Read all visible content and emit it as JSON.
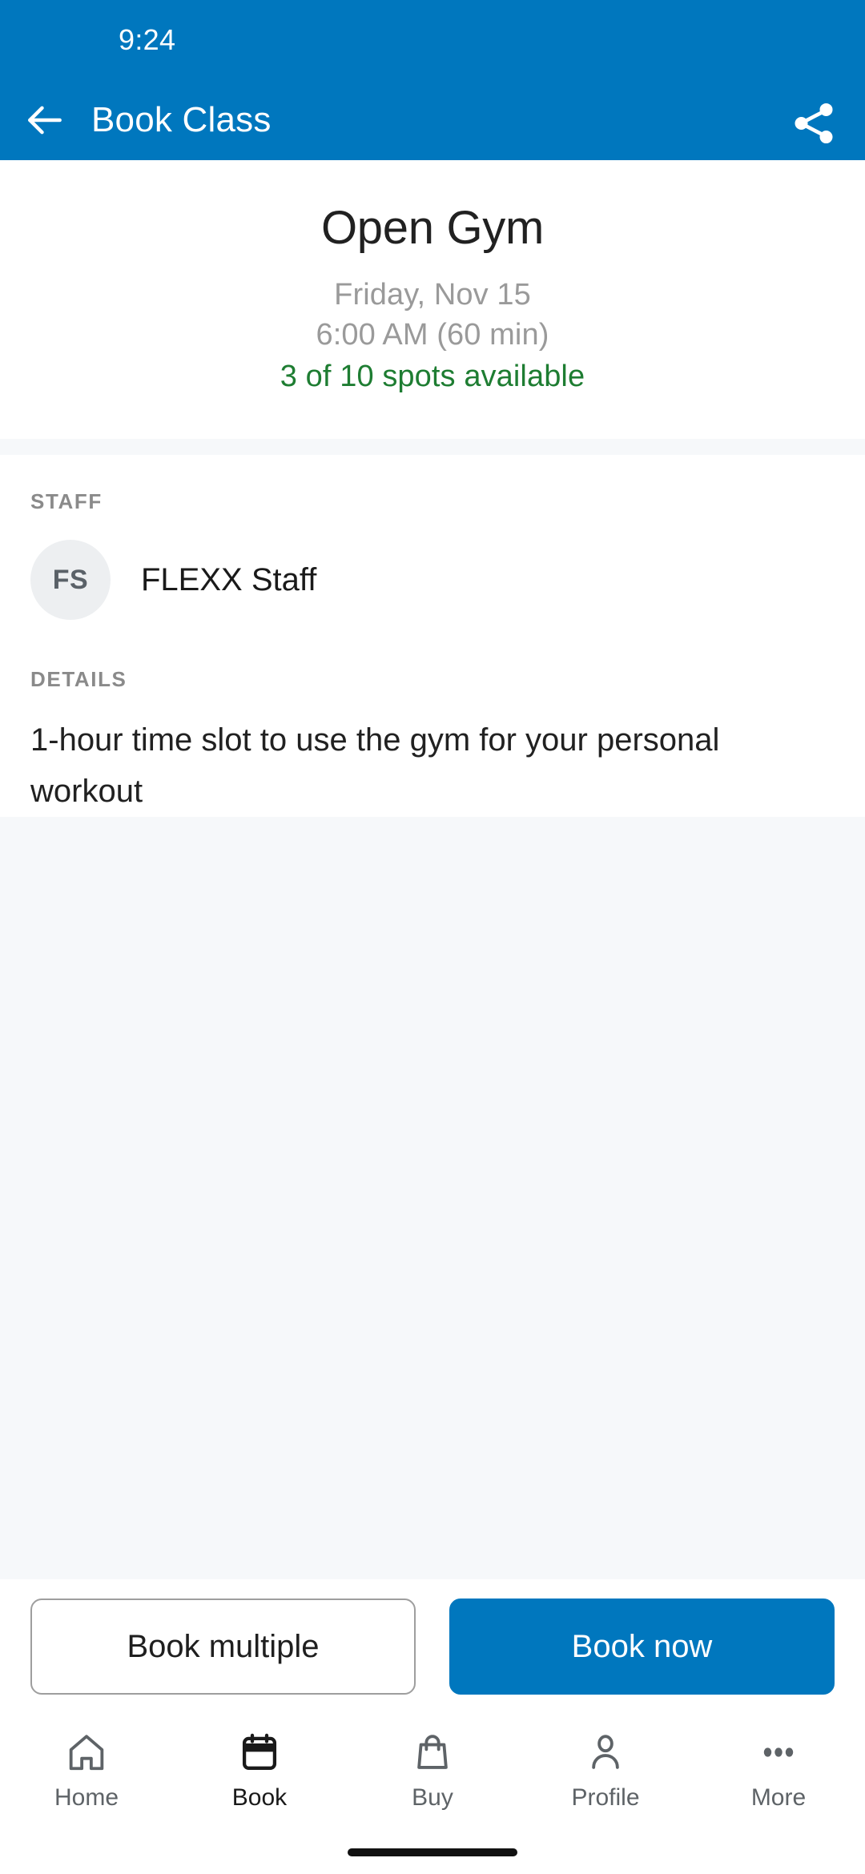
{
  "theme": {
    "primary": "#0077BE",
    "success_green": "#1E7D32",
    "muted_gray": "#9a9a9a",
    "band_gray": "#F6F8FA",
    "avatar_bg": "#EDEFF1"
  },
  "status_bar": {
    "time": "9:24"
  },
  "app_bar": {
    "title": "Book Class",
    "back_icon": "arrow-left-icon",
    "share_icon": "share-icon"
  },
  "class": {
    "name": "Open Gym",
    "date": "Friday, Nov 15",
    "time": "6:00 AM (60 min)",
    "spots": "3 of 10 spots available",
    "spots_available": 3,
    "spots_total": 10
  },
  "staff": {
    "label": "STAFF",
    "avatar_initials": "FS",
    "name": "FLEXX Staff"
  },
  "details": {
    "label": "DETAILS",
    "text": "1-hour time slot to use the gym for your personal workout"
  },
  "actions": {
    "secondary_label": "Book multiple",
    "primary_label": "Book now"
  },
  "bottom_nav": {
    "items": [
      {
        "label": "Home",
        "icon": "home-icon",
        "active": false
      },
      {
        "label": "Book",
        "icon": "calendar-icon",
        "active": true
      },
      {
        "label": "Buy",
        "icon": "shopping-bag-icon",
        "active": false
      },
      {
        "label": "Profile",
        "icon": "person-icon",
        "active": false
      },
      {
        "label": "More",
        "icon": "ellipsis-icon",
        "active": false
      }
    ]
  }
}
